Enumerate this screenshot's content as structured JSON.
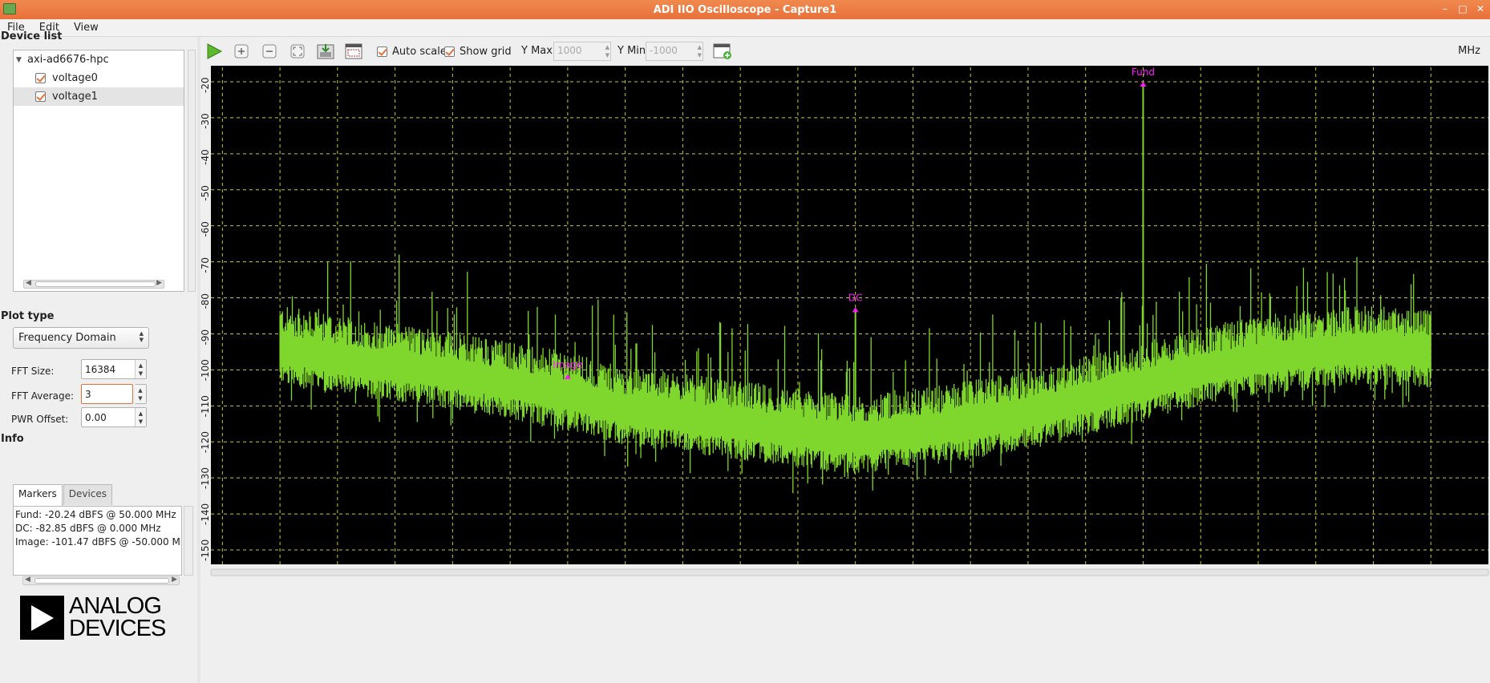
{
  "window": {
    "title": "ADI IIO Oscilloscope - Capture1"
  },
  "menu": [
    "File",
    "Edit",
    "View"
  ],
  "device_list": {
    "title": "Device list",
    "device": "axi-ad6676-hpc",
    "channels": [
      {
        "label": "voltage0",
        "checked": true
      },
      {
        "label": "voltage1",
        "checked": true
      }
    ]
  },
  "plot_type": {
    "title": "Plot type",
    "value": "Frequency Domain"
  },
  "fft": {
    "size_label": "FFT Size:",
    "size": "16384",
    "avg_label": "FFT Average:",
    "avg": "3",
    "pwr_label": "PWR Offset:",
    "pwr": "0.00"
  },
  "info": {
    "title": "Info",
    "tabs": [
      "Markers",
      "Devices"
    ],
    "lines": [
      "Fund: -20.24 dBFS @ 50.000 MHz",
      "DC: -82.85 dBFS @ 0.000 MHz",
      "Image: -101.47 dBFS @ -50.000 MHz"
    ]
  },
  "logo": {
    "line1": "ANALOG",
    "line2": "DEVICES"
  },
  "toolbar": {
    "auto_scale": "Auto scale",
    "auto_scale_on": true,
    "show_grid": "Show grid",
    "show_grid_on": true,
    "ymax_label": "Y Max:",
    "ymax": "1000",
    "ymin_label": "Y Min:",
    "ymin": "-1000",
    "units": "MHz"
  },
  "colors": {
    "trace": "#7fd62c",
    "marker": "#ff19ff",
    "grid": "#c8c832",
    "bg": "#000000",
    "accent": "#e8703a"
  },
  "chart_data": {
    "type": "line",
    "xlabel": "",
    "ylabel": "",
    "xlim": [
      -112,
      110
    ],
    "ylim": [
      -154,
      -16
    ],
    "x_ticks": [
      -110,
      -100,
      -90,
      -80,
      -70,
      -60,
      -50,
      -40,
      -30,
      -20,
      -10,
      0,
      10,
      20,
      30,
      40,
      50,
      60,
      70,
      80,
      90,
      100
    ],
    "y_ticks": [
      -20,
      -30,
      -40,
      -50,
      -60,
      -70,
      -80,
      -90,
      -100,
      -110,
      -120,
      -130,
      -140,
      -150
    ],
    "grid": true,
    "series": [
      {
        "x": [
          -100,
          -90,
          -80,
          -70,
          -60,
          -50,
          -40,
          -30,
          -20,
          -10,
          0,
          10,
          20,
          30,
          40,
          45,
          50,
          55,
          60,
          70,
          80,
          90,
          100
        ],
        "y": [
          -94,
          -97,
          -99,
          -101,
          -104,
          -107,
          -111,
          -113,
          -115,
          -117,
          -119,
          -117,
          -115,
          -112,
          -108,
          -106,
          -104,
          -102,
          -100,
          -97,
          -95,
          -94,
          -95
        ]
      }
    ],
    "markers": [
      {
        "label": "Fund",
        "x": 50,
        "y": -20.24
      },
      {
        "label": "DC",
        "x": 0,
        "y": -82.85
      },
      {
        "label": "Image",
        "x": -50,
        "y": -101.47
      }
    ]
  }
}
